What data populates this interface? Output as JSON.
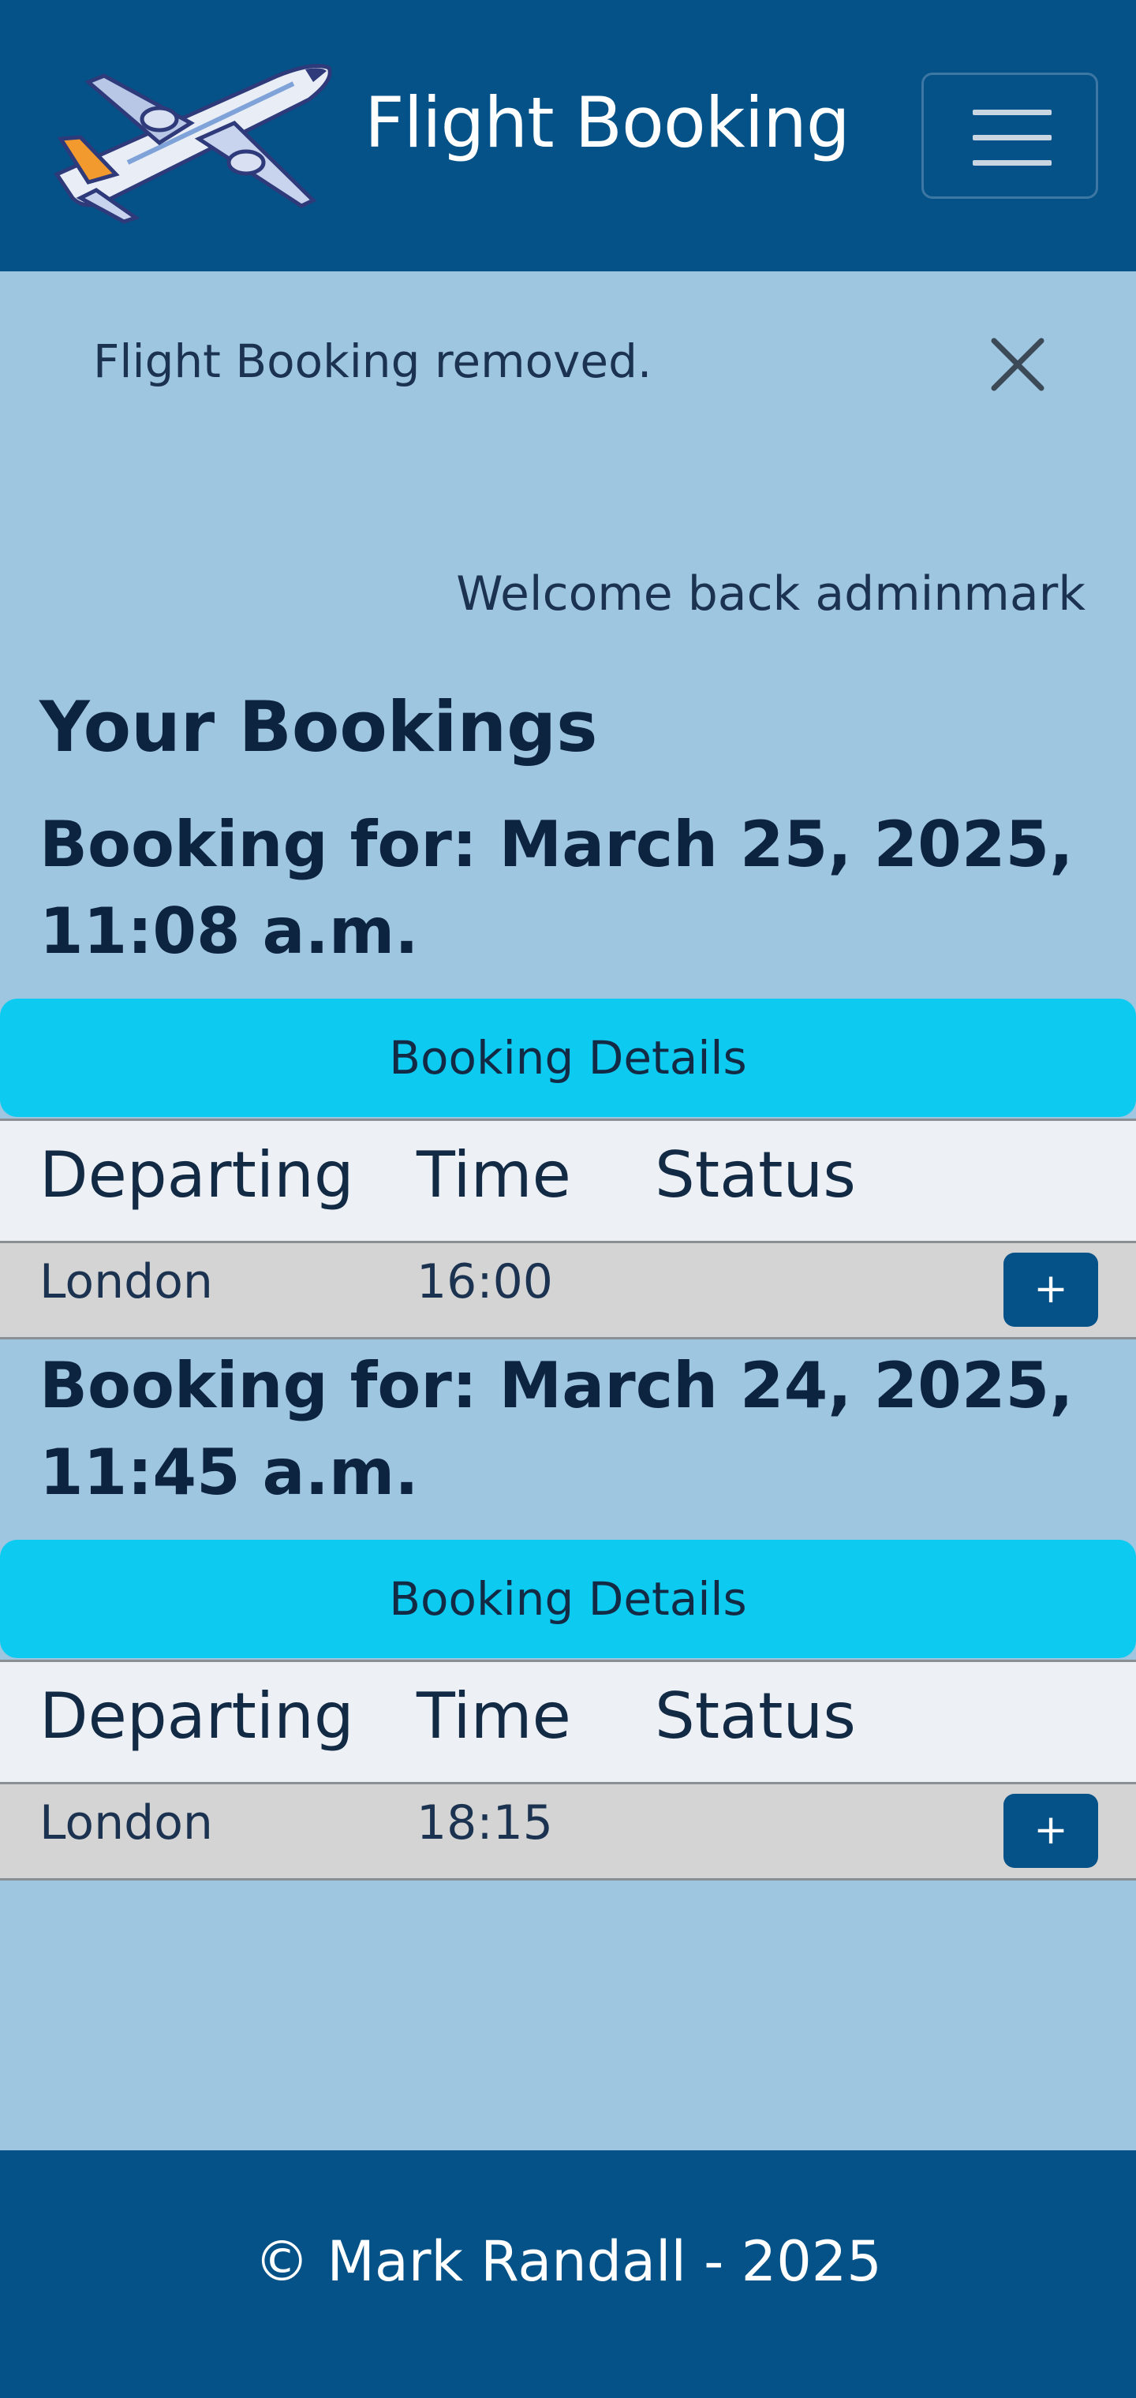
{
  "header": {
    "brand": "Flight Booking",
    "logo_icon": "airplane-icon",
    "menu_icon": "hamburger-menu-icon"
  },
  "alert": {
    "message": "Flight Booking removed.",
    "close_icon": "close-icon"
  },
  "welcome": "Welcome back adminmark",
  "page_title": "Your Bookings",
  "bookings": [
    {
      "title_line1": "Booking for: March 25, 2025,",
      "title_line2": "11:08 a.m.",
      "details_label": "Booking Details",
      "columns": [
        "Departing",
        "Time",
        "Status"
      ],
      "row": {
        "departing": "London",
        "time": "16:00",
        "status": ""
      },
      "expand_label": "+"
    },
    {
      "title_line1": "Booking for: March 24, 2025,",
      "title_line2": "11:45 a.m.",
      "details_label": "Booking Details",
      "columns": [
        "Departing",
        "Time",
        "Status"
      ],
      "row": {
        "departing": "London",
        "time": "18:15",
        "status": ""
      },
      "expand_label": "+"
    }
  ],
  "footer": {
    "copyright_symbol": "©",
    "text": "Mark Randall - 2025"
  },
  "colors": {
    "navbar": "#045287",
    "page_bg": "#9fc6e0",
    "details_button": "#0dcaf0",
    "table_header": "#edf1f6",
    "table_row": "#d4d4d4",
    "plus_button": "#045287"
  }
}
